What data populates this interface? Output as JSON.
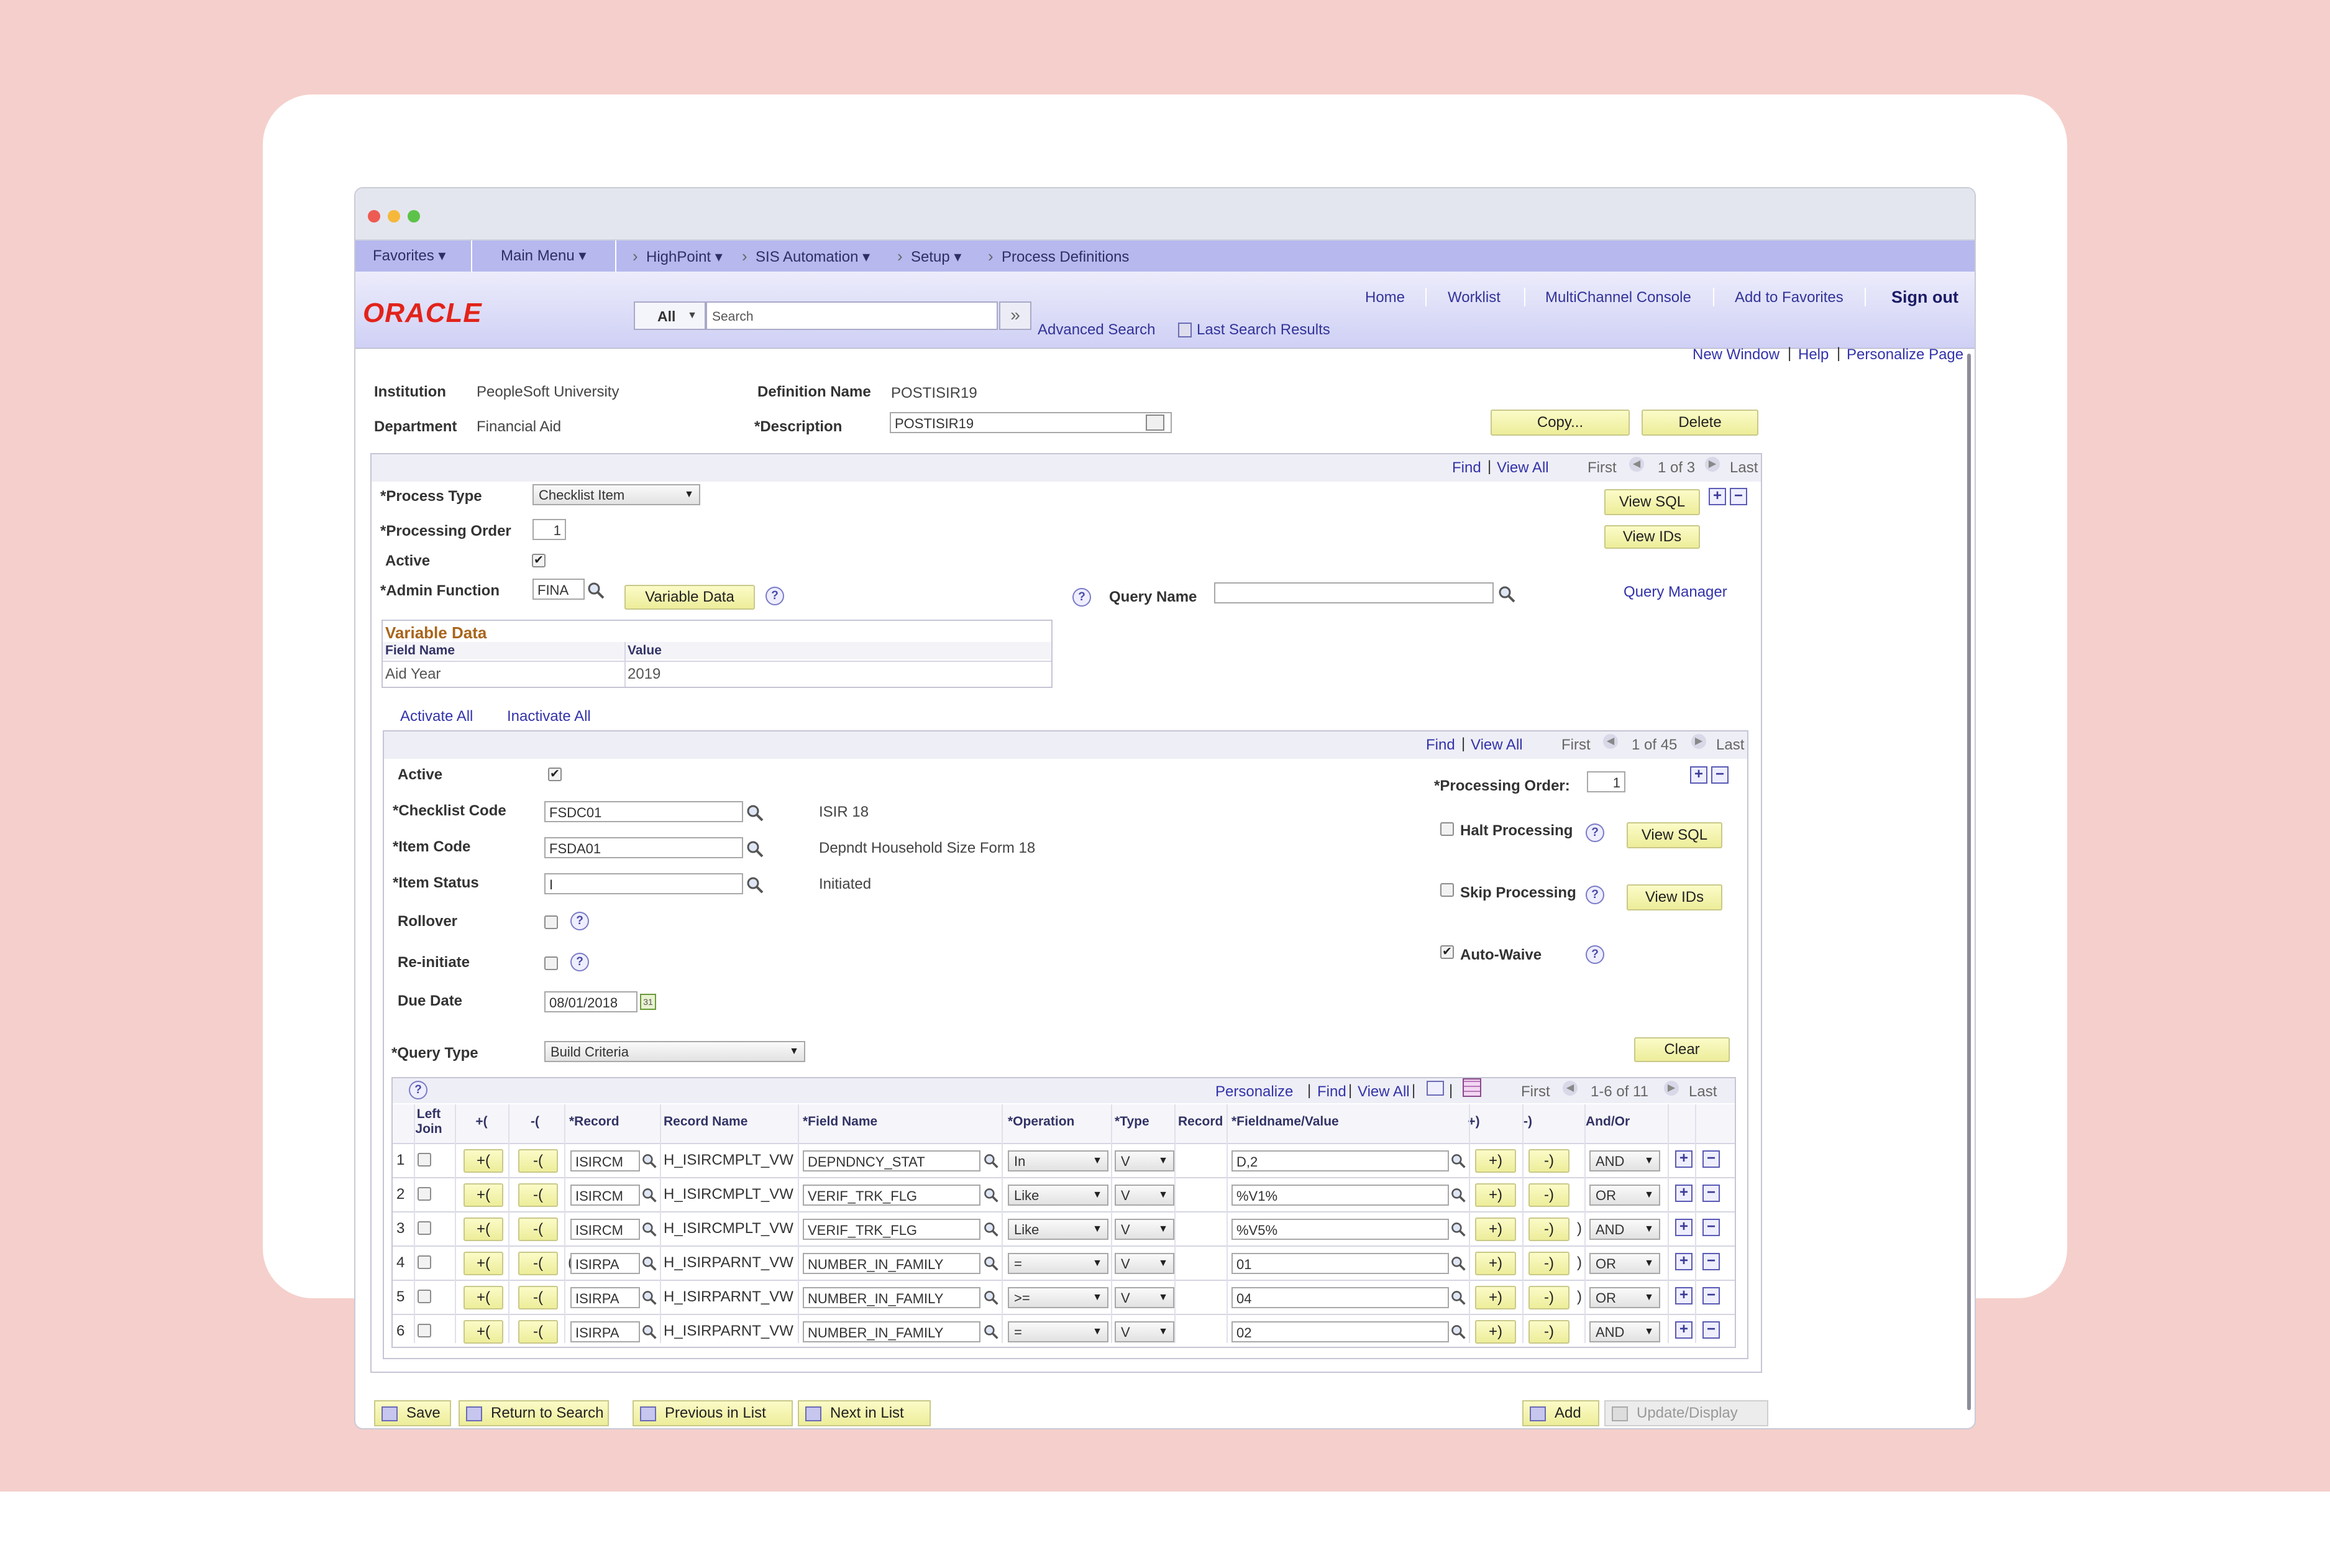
{
  "nav": {
    "favorites": "Favorites",
    "main_menu": "Main Menu",
    "crumbs": [
      "HighPoint",
      "SIS Automation",
      "Setup",
      "Process Definitions"
    ]
  },
  "header": {
    "logo": "ORACLE",
    "links": [
      "Home",
      "Worklist",
      "MultiChannel Console",
      "Add to Favorites"
    ],
    "sign_out": "Sign out",
    "search_scope": "All",
    "search_placeholder": "Search",
    "advanced_search": "Advanced Search",
    "last_search_results": "Last Search Results"
  },
  "page_links": {
    "new_window": "New Window",
    "help": "Help",
    "personalize": "Personalize Page"
  },
  "definition": {
    "institution_label": "Institution",
    "institution": "PeopleSoft University",
    "department_label": "Department",
    "department": "Financial Aid",
    "def_name_label": "Definition Name",
    "def_name": "POSTISIR19",
    "description_label": "*Description",
    "description": "POSTISIR19",
    "copy": "Copy...",
    "delete": "Delete"
  },
  "process": {
    "find": "Find",
    "view_all": "View All",
    "first": "First",
    "count": "1 of 3",
    "last": "Last",
    "type_label": "*Process Type",
    "type": "Checklist Item",
    "order_label": "*Processing Order",
    "order": "1",
    "active_label": "Active",
    "admin_label": "*Admin Function",
    "admin": "FINA",
    "variable_data_btn": "Variable Data",
    "query_name_label": "Query Name",
    "query_manager": "Query Manager",
    "view_sql": "View SQL",
    "view_ids": "View IDs"
  },
  "variable_data": {
    "title": "Variable Data",
    "col_field": "Field Name",
    "col_value": "Value",
    "rows": [
      {
        "field": "Aid Year",
        "value": "2019"
      }
    ]
  },
  "activate_all": "Activate All",
  "inactivate_all": "Inactivate All",
  "item": {
    "find": "Find",
    "view_all": "View All",
    "first": "First",
    "count": "1 of 45",
    "last": "Last",
    "active_label": "Active",
    "proc_order_label": "*Processing Order:",
    "proc_order": "1",
    "checklist_label": "*Checklist Code",
    "checklist": "FSDC01",
    "checklist_desc": "ISIR 18",
    "item_label": "*Item Code",
    "item": "FSDA01",
    "item_desc": "Depndt Household Size Form 18",
    "status_label": "*Item Status",
    "status": "I",
    "status_desc": "Initiated",
    "rollover_label": "Rollover",
    "reinit_label": "Re-initiate",
    "due_label": "Due Date",
    "due": "08/01/2018",
    "halt_label": "Halt Processing",
    "skip_label": "Skip Processing",
    "waive_label": "Auto-Waive",
    "view_sql": "View SQL",
    "view_ids": "View IDs",
    "query_type_label": "*Query Type",
    "query_type": "Build Criteria",
    "clear": "Clear"
  },
  "criteria": {
    "personalize": "Personalize",
    "find": "Find",
    "view_all": "View All",
    "first": "First",
    "count": "1-6 of 11",
    "last": "Last",
    "headers": {
      "left_join": "Left Join",
      "open": "+(",
      "close": "-(",
      "record": "*Record",
      "record_name": "Record Name",
      "field_name": "*Field Name",
      "operation": "*Operation",
      "type": "*Type",
      "record2": "Record",
      "fieldvalue": "*Fieldname/Value",
      "rparen_add": "+)",
      "rparen_del": "-)",
      "andor": "And/Or"
    },
    "rows": [
      {
        "n": "1",
        "paren": "",
        "record": "ISIRCM",
        "rname": "H_ISIRCMPLT_VW",
        "field": "DEPNDNCY_STAT",
        "op": "In",
        "type": "V",
        "value": "D,2",
        "rp": "",
        "andor": "AND"
      },
      {
        "n": "2",
        "paren": "(",
        "record": "ISIRCM",
        "rname": "H_ISIRCMPLT_VW",
        "field": "VERIF_TRK_FLG",
        "op": "Like",
        "type": "V",
        "value": "%V1%",
        "rp": "",
        "andor": "OR"
      },
      {
        "n": "3",
        "paren": "",
        "record": "ISIRCM",
        "rname": "H_ISIRCMPLT_VW",
        "field": "VERIF_TRK_FLG",
        "op": "Like",
        "type": "V",
        "value": "%V5%",
        "rp": ")",
        "andor": "AND"
      },
      {
        "n": "4",
        "paren": "((",
        "record": "ISIRPA",
        "rname": "H_ISIRPARNT_VW",
        "field": "NUMBER_IN_FAMILY",
        "op": "=",
        "type": "V",
        "value": "01",
        "rp": ")",
        "andor": "OR"
      },
      {
        "n": "5",
        "paren": "(",
        "record": "ISIRPA",
        "rname": "H_ISIRPARNT_VW",
        "field": "NUMBER_IN_FAMILY",
        "op": ">=",
        "type": "V",
        "value": "04",
        "rp": ")",
        "andor": "OR"
      },
      {
        "n": "6",
        "paren": "(",
        "record": "ISIRPA",
        "rname": "H_ISIRPARNT_VW",
        "field": "NUMBER_IN_FAMILY",
        "op": "=",
        "type": "V",
        "value": "02",
        "rp": "",
        "andor": "AND"
      }
    ]
  },
  "toolbar": {
    "save": "Save",
    "return": "Return to Search",
    "prev": "Previous in List",
    "next": "Next in List",
    "add": "Add",
    "update": "Update/Display"
  }
}
